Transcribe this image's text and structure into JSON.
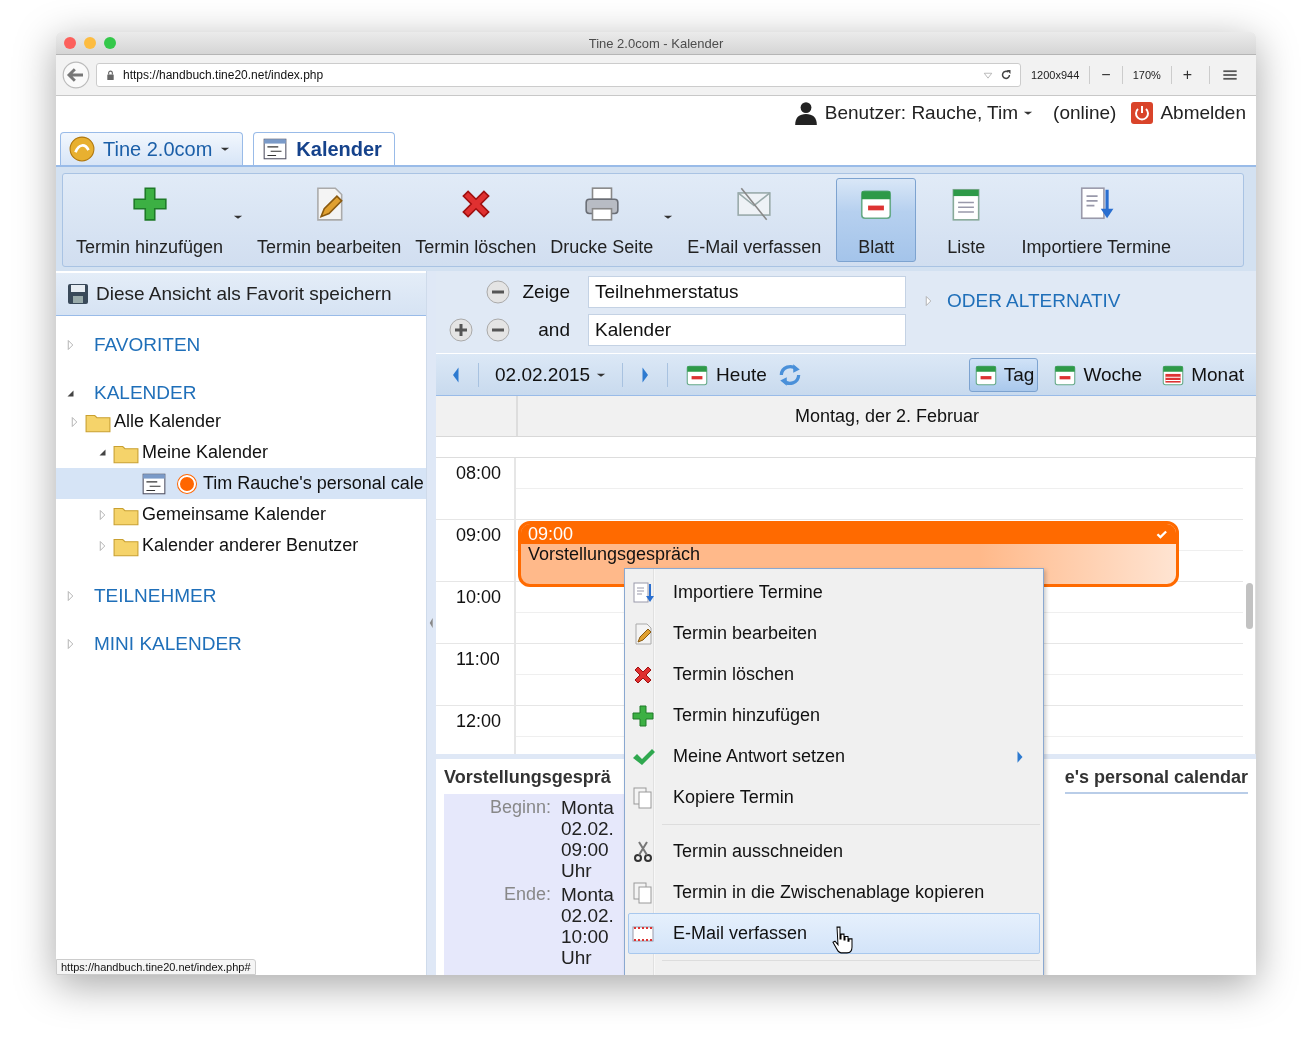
{
  "window": {
    "title": "Tine 2.0com - Kalender"
  },
  "address_bar": {
    "url": "https://handbuch.tine20.net/index.php",
    "viewport": "1200x944",
    "zoom_out": "−",
    "zoom": "170%",
    "zoom_in": "+"
  },
  "user_bar": {
    "user": "Benutzer: Rauche, Tim",
    "status": "(online)",
    "logout": "Abmelden"
  },
  "app_tabs": [
    {
      "label": "Tine 2.0com",
      "kind": "app",
      "menu": true,
      "selected": false
    },
    {
      "label": "Kalender",
      "kind": "calendar",
      "menu": false,
      "selected": true
    }
  ],
  "toolbar": [
    {
      "label": "Termin hinzufügen",
      "kind": "add",
      "menu": true,
      "selected": false
    },
    {
      "label": "Termin bearbeiten",
      "kind": "edit",
      "menu": false,
      "selected": false
    },
    {
      "label": "Termin löschen",
      "kind": "delete",
      "menu": false,
      "selected": false
    },
    {
      "label": "Drucke Seite",
      "kind": "print",
      "menu": true,
      "selected": false
    },
    {
      "label": "E-Mail verfassen",
      "kind": "email",
      "menu": false,
      "selected": false
    },
    {
      "label": "Blatt",
      "kind": "sheet",
      "menu": false,
      "selected": true
    },
    {
      "label": "Liste",
      "kind": "list",
      "menu": false,
      "selected": false
    },
    {
      "label": "Importiere Termine",
      "kind": "import",
      "menu": false,
      "selected": false
    }
  ],
  "sidebar": {
    "save_favorite": "Diese Ansicht als Favorit speichern",
    "sections": [
      {
        "label": "FAVORITEN",
        "expanded": false
      },
      {
        "label": "KALENDER",
        "expanded": true,
        "children": [
          {
            "label": "Alle Kalender",
            "kind": "folder",
            "expanded": false,
            "selected": false,
            "children": [
              {
                "label": "Meine Kalender",
                "kind": "folder",
                "expanded": true,
                "selected": false,
                "children": [
                  {
                    "label": "Tim Rauche's personal cale",
                    "kind": "calendar",
                    "selected": true,
                    "color": "#ff6600"
                  }
                ]
              },
              {
                "label": "Gemeinsame Kalender",
                "kind": "folder",
                "expanded": false,
                "selected": false
              },
              {
                "label": "Kalender anderer Benutzer",
                "kind": "folder",
                "expanded": false,
                "selected": false
              }
            ]
          }
        ]
      },
      {
        "label": "TEILNEHMER",
        "expanded": false
      },
      {
        "label": "MINI KALENDER",
        "expanded": false
      }
    ]
  },
  "filter": {
    "rows": [
      {
        "label": "Zeige",
        "value": "Teilnehmerstatus",
        "can_add": false
      },
      {
        "label": "and",
        "value": "Kalender",
        "can_add": true
      }
    ],
    "alternative": "ODER ALTERNATIV"
  },
  "date_toolbar": {
    "date": "02.02.2015",
    "today": "Heute",
    "views": [
      {
        "label": "Tag",
        "kind": "day",
        "selected": true
      },
      {
        "label": "Woche",
        "kind": "week",
        "selected": false
      },
      {
        "label": "Monat",
        "kind": "month",
        "selected": false
      }
    ]
  },
  "day_view": {
    "header": "Montag, der 2. Februar",
    "hours": [
      "08:00",
      "09:00",
      "10:00",
      "11:00",
      "12:00"
    ],
    "events": [
      {
        "time": "09:00",
        "title": "Vorstellungsgespräch",
        "confirmed": true
      }
    ]
  },
  "details": {
    "title": "Vorstellungsgesprä",
    "calendar": "e's personal calendar",
    "fields": [
      {
        "label": "Beginn:",
        "lines": [
          "Monta",
          "02.02.",
          "09:00",
          "Uhr"
        ]
      },
      {
        "label": "Ende:",
        "lines": [
          "Monta",
          "02.02.",
          "10:00",
          "Uhr"
        ]
      }
    ]
  },
  "context_menu": [
    {
      "kind": "import",
      "label": "Importiere Termine",
      "submenu": false,
      "selected": false
    },
    {
      "kind": "edit",
      "label": "Termin bearbeiten",
      "submenu": false,
      "selected": false
    },
    {
      "kind": "delete",
      "label": "Termin löschen",
      "submenu": false,
      "selected": false
    },
    {
      "kind": "add",
      "label": "Termin hinzufügen",
      "submenu": false,
      "selected": false
    },
    {
      "kind": "respond",
      "label": "Meine Antwort setzen",
      "submenu": true,
      "selected": false
    },
    {
      "kind": "copy",
      "label": "Kopiere Termin",
      "submenu": false,
      "selected": false
    },
    {
      "kind": "separator"
    },
    {
      "kind": "cut",
      "label": "Termin ausschneiden",
      "submenu": false,
      "selected": false
    },
    {
      "kind": "clipboard",
      "label": "Termin in die Zwischenablage kopieren",
      "submenu": false,
      "selected": false
    },
    {
      "kind": "email",
      "label": "E-Mail verfassen",
      "submenu": false,
      "selected": true
    },
    {
      "kind": "separator"
    }
  ],
  "status_url": "https://handbuch.tine20.net/index.php#"
}
